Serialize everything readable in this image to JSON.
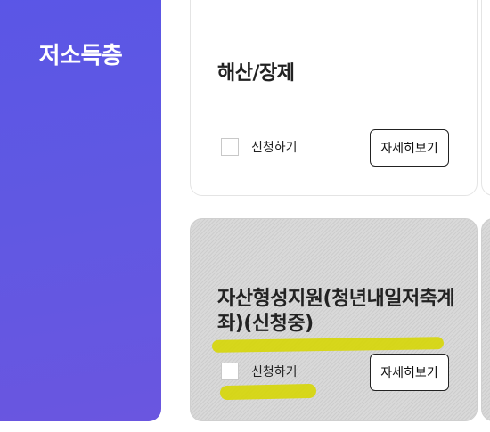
{
  "sidebar": {
    "title": "저소득층"
  },
  "cards": [
    {
      "title": "해산/장제",
      "apply_label": "신청하기",
      "detail_label": "자세히보기"
    },
    {
      "title": "자산형성지원(청년내일저축계좌)(신청중)",
      "apply_label": "신청하기",
      "detail_label": "자세히보기"
    }
  ],
  "colors": {
    "sidebar_gradient_start": "#5a56e6",
    "sidebar_gradient_end": "#6a56e0",
    "highlight": "#d6d600"
  }
}
